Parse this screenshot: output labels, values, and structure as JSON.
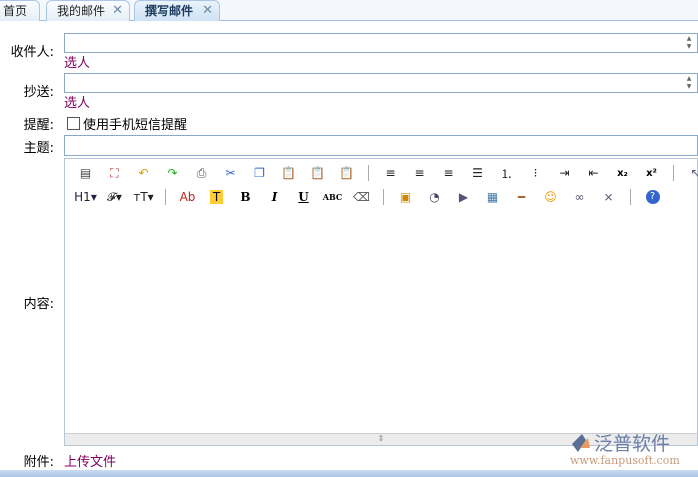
{
  "tabs": [
    {
      "label": "首页"
    },
    {
      "label": "我的邮件",
      "close": "✕"
    },
    {
      "label": "撰写邮件",
      "close": "✕",
      "active": true
    }
  ],
  "form": {
    "to_label": "收件人:",
    "to_value": "",
    "to_pick": "选人",
    "cc_label": "抄送:",
    "cc_value": "",
    "cc_pick": "选人",
    "remind_label": "提醒:",
    "sms_remind": "使用手机短信提醒",
    "sms_checked": false,
    "subject_label": "主题:",
    "subject_value": "",
    "content_label": "内容:",
    "attach_label": "附件:",
    "upload_link": "上传文件"
  },
  "toolbar": {
    "row1": [
      "source",
      "fullscreen",
      "undo",
      "redo",
      "print",
      "cut",
      "copy",
      "paste",
      "paste-text",
      "paste-word",
      "|",
      "align-left",
      "align-center",
      "align-right",
      "align-justify",
      "ordered-list",
      "unordered-list",
      "indent",
      "outdent",
      "subscript",
      "superscript",
      "|",
      "select-all"
    ],
    "row2": [
      "H1",
      "font",
      "font-size",
      "|",
      "Ab",
      "T",
      "B",
      "I",
      "U",
      "ABC",
      "eraser",
      "|",
      "image",
      "flash",
      "media",
      "table",
      "hr",
      "emoticon",
      "link",
      "unlink",
      "|",
      "help"
    ]
  },
  "logo": {
    "name": "泛普软件",
    "url": "www.fanpusoft.com"
  }
}
